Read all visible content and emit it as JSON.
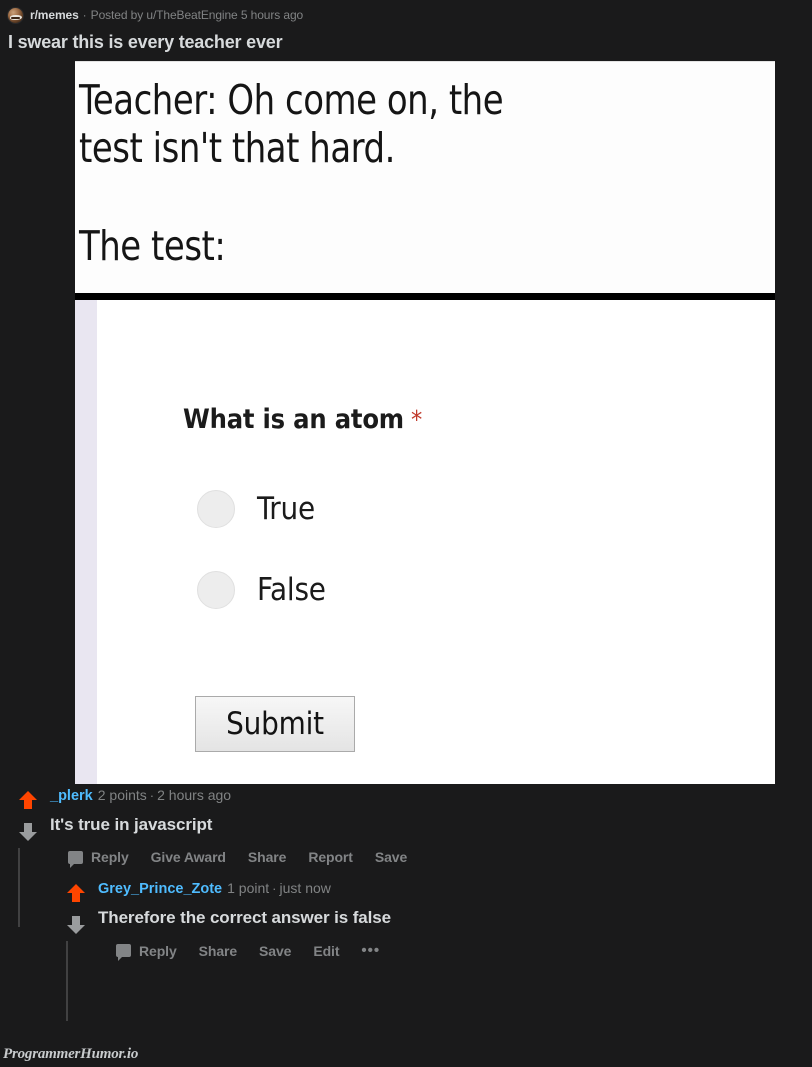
{
  "post": {
    "subreddit": "r/memes",
    "meta_separator": "·",
    "posted_by": "Posted by u/TheBeatEngine 5 hours ago",
    "title": "I swear this is every teacher ever",
    "avatar_icon": "subreddit-avatar"
  },
  "meme": {
    "top_line_1": "Teacher: Oh come on, the",
    "top_line_2": "test isn't that hard.",
    "top_line_3": "The test:",
    "form": {
      "question": "What is an atom",
      "required_marker": "*",
      "options": [
        {
          "label": "True"
        },
        {
          "label": "False"
        }
      ],
      "submit_label": "Submit"
    }
  },
  "comments": [
    {
      "author": "_plerk",
      "points": "2 points",
      "separator": "·",
      "timestamp": "2 hours ago",
      "body": "It's true in javascript",
      "actions": [
        "Reply",
        "Give Award",
        "Share",
        "Report",
        "Save"
      ],
      "upvote_icon": "arrow-up-icon",
      "downvote_icon": "arrow-down-icon",
      "reply_icon": "speech-bubble-icon"
    },
    {
      "author": "Grey_Prince_Zote",
      "points": "1 point",
      "separator": "·",
      "timestamp": "just now",
      "body": "Therefore the correct answer is false",
      "actions": [
        "Reply",
        "Share",
        "Save",
        "Edit"
      ],
      "more_label": "•••",
      "upvote_icon": "arrow-up-icon",
      "downvote_icon": "arrow-down-icon",
      "reply_icon": "speech-bubble-icon"
    }
  ],
  "watermark": "ProgrammerHumor.io",
  "colors": {
    "background": "#1a1a1b",
    "upvote": "#ff4500",
    "downvote": "#9a9c9e",
    "link": "#4fbcff",
    "muted": "#818384",
    "required_star": "#c0392b",
    "form_strip": "#e9e6f1"
  }
}
